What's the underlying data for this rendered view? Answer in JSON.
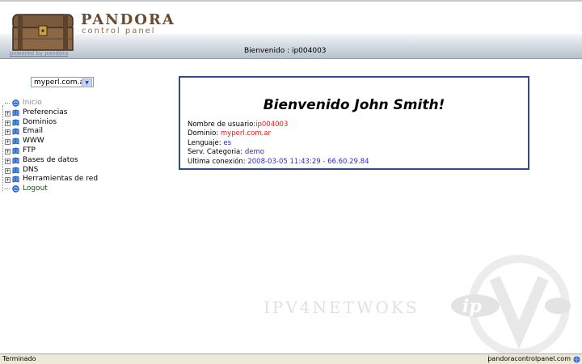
{
  "header": {
    "logo_title": "PANDORA",
    "logo_subtitle": "control panel",
    "powered": "powered by pandora",
    "welcome": "Bienvenido : ip004003"
  },
  "sidebar": {
    "domain_select": "myperl.com.ar",
    "items": [
      {
        "label": "Inicio",
        "expandable": false
      },
      {
        "label": "Preferencias",
        "expandable": true
      },
      {
        "label": "Dominios",
        "expandable": true
      },
      {
        "label": "Email",
        "expandable": true
      },
      {
        "label": "WWW",
        "expandable": true
      },
      {
        "label": "FTP",
        "expandable": true
      },
      {
        "label": "Bases de datos",
        "expandable": true
      },
      {
        "label": "DNS",
        "expandable": true
      },
      {
        "label": "Herramientas de red",
        "expandable": true
      },
      {
        "label": "Logout",
        "expandable": false
      }
    ]
  },
  "main": {
    "title": "Bienvenido John Smith!",
    "rows": [
      {
        "label": "Nombre de usuario:",
        "value": "ip004003"
      },
      {
        "label": "Dominio: ",
        "value": "myperl.com.ar"
      },
      {
        "label": "Lenguaje: ",
        "value": "es"
      },
      {
        "label": "Serv. Categoria: ",
        "value": "demo"
      },
      {
        "label": "Ultima conexión: ",
        "value": "2008-03-05 11:43:29 - 66.60.29.84"
      }
    ]
  },
  "watermark": {
    "text": "IPV4NETWOKS",
    "logo_text": "ip"
  },
  "statusbar": {
    "left": "Terminado",
    "right": "pandoracontrolpanel.com"
  },
  "colors": {
    "box_border": "#2e4c8c",
    "value_red": "#e0201a",
    "value_blue": "#2a2ad8"
  }
}
